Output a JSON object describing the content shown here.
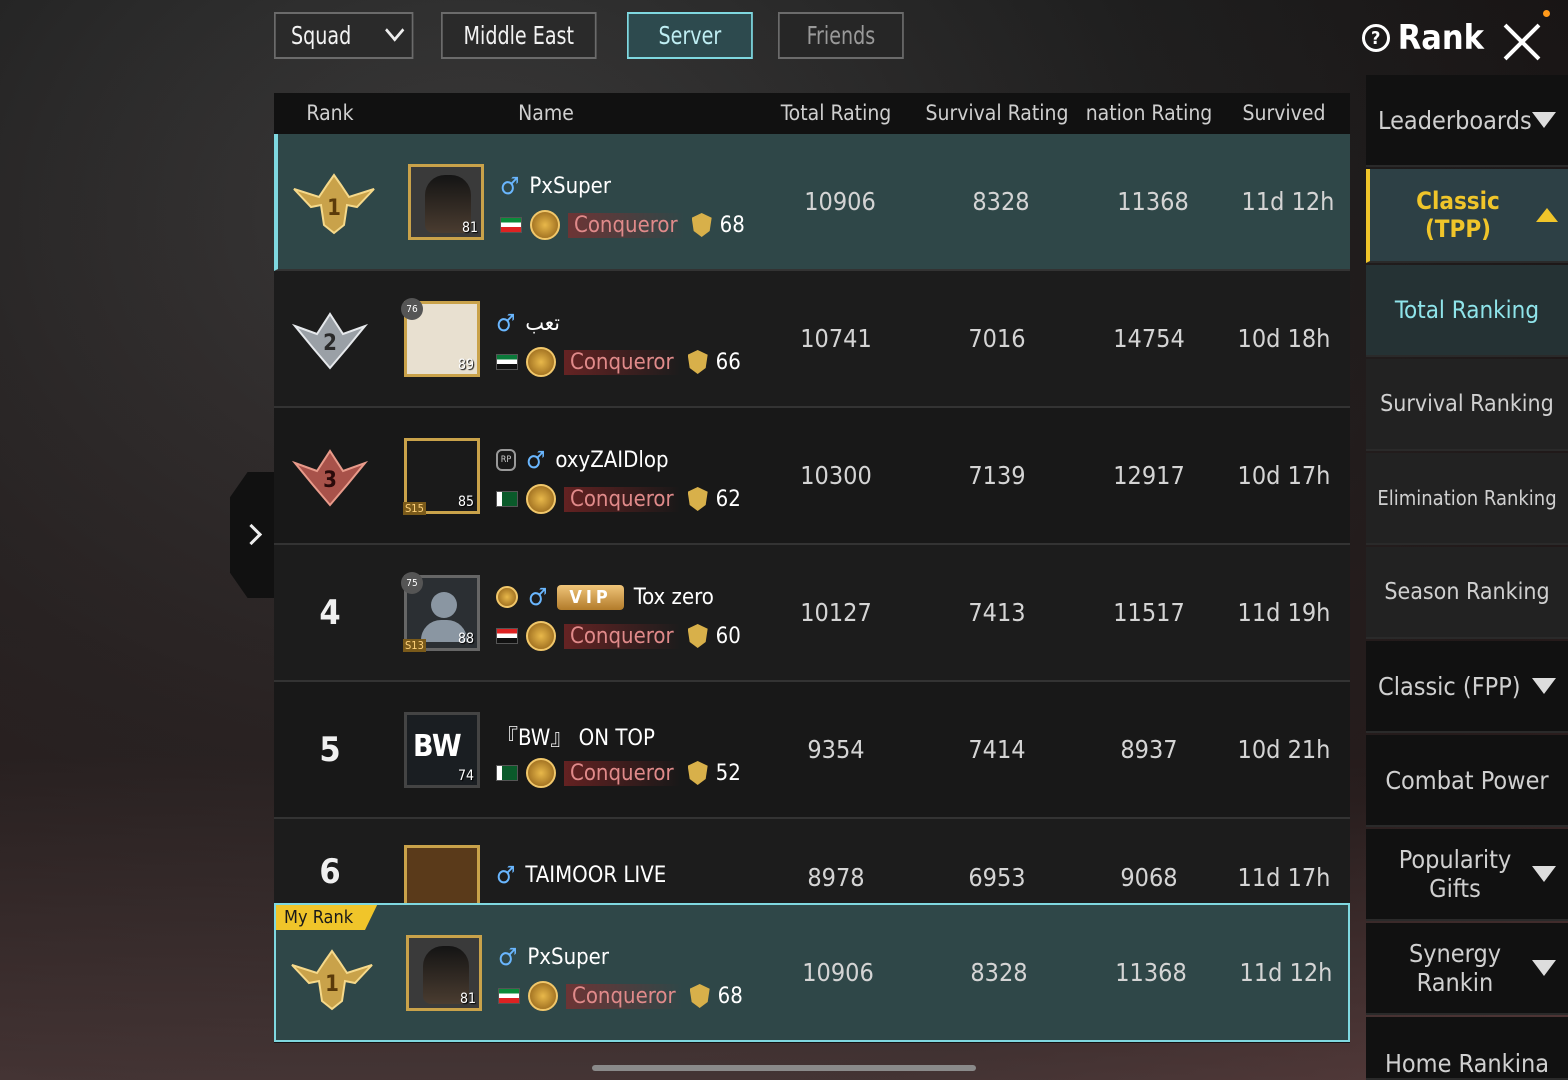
{
  "top_tabs": {
    "mode": "Squad",
    "region": "Middle East",
    "server": "Server",
    "friends": "Friends"
  },
  "header": {
    "title": "Rank"
  },
  "columns": {
    "rank": "Rank",
    "name": "Name",
    "total": "Total Rating",
    "survival": "Survival Rating",
    "elimination": "nation Rating",
    "survived": "Survived"
  },
  "rows": [
    {
      "rank": "1",
      "level": "81",
      "name": "PxSuper",
      "tier": "Conqueror",
      "stars": "68",
      "total": "10906",
      "survival": "8328",
      "elim": "11368",
      "survived": "11d 12h"
    },
    {
      "rank": "2",
      "level": "89",
      "badge": "76",
      "name": "تعب",
      "tier": "Conqueror",
      "stars": "66",
      "total": "10741",
      "survival": "7016",
      "elim": "14754",
      "survived": "10d 18h"
    },
    {
      "rank": "3",
      "level": "85",
      "season": "S15",
      "name": "oxyZAIDlop",
      "tier": "Conqueror",
      "stars": "62",
      "total": "10300",
      "survival": "7139",
      "elim": "12917",
      "survived": "10d 17h"
    },
    {
      "rank": "4",
      "level": "88",
      "badge": "75",
      "season": "S13",
      "vip": "VIP",
      "name": "Tox zero",
      "tier": "Conqueror",
      "stars": "60",
      "total": "10127",
      "survival": "7413",
      "elim": "11517",
      "survived": "11d 19h"
    },
    {
      "rank": "5",
      "level": "74",
      "avatar_text": "BW",
      "name": "『BW』 ON TOP",
      "tier": "Conqueror",
      "stars": "52",
      "total": "9354",
      "survival": "7414",
      "elim": "8937",
      "survived": "10d 21h"
    },
    {
      "rank": "6",
      "name": "TAIMOOR LIVE",
      "total": "8978",
      "survival": "6953",
      "elim": "9068",
      "survived": "11d 17h"
    }
  ],
  "my_rank": {
    "tag": "My Rank",
    "rank": "1",
    "level": "81",
    "name": "PxSuper",
    "tier": "Conqueror",
    "stars": "68",
    "total": "10906",
    "survival": "8328",
    "elim": "11368",
    "survived": "11d 12h"
  },
  "sidebar": {
    "leaderboards": "Leaderboards",
    "classic_tpp": "Classic (TPP)",
    "total_ranking": "Total Ranking",
    "survival_ranking": "Survival Ranking",
    "elimination_ranking": "Elimination Ranking",
    "season_ranking": "Season Ranking",
    "classic_fpp": "Classic (FPP)",
    "combat_power": "Combat Power",
    "popularity_gifts": "Popularity Gifts",
    "synergy_ranking": "Synergy Rankin",
    "home_ranking": "Home Rankina"
  },
  "colors": {
    "accent_cyan": "#7fd8e0",
    "accent_gold": "#f0c52a",
    "selected_row": "#2f4748",
    "tier_text": "#e08a8a"
  }
}
